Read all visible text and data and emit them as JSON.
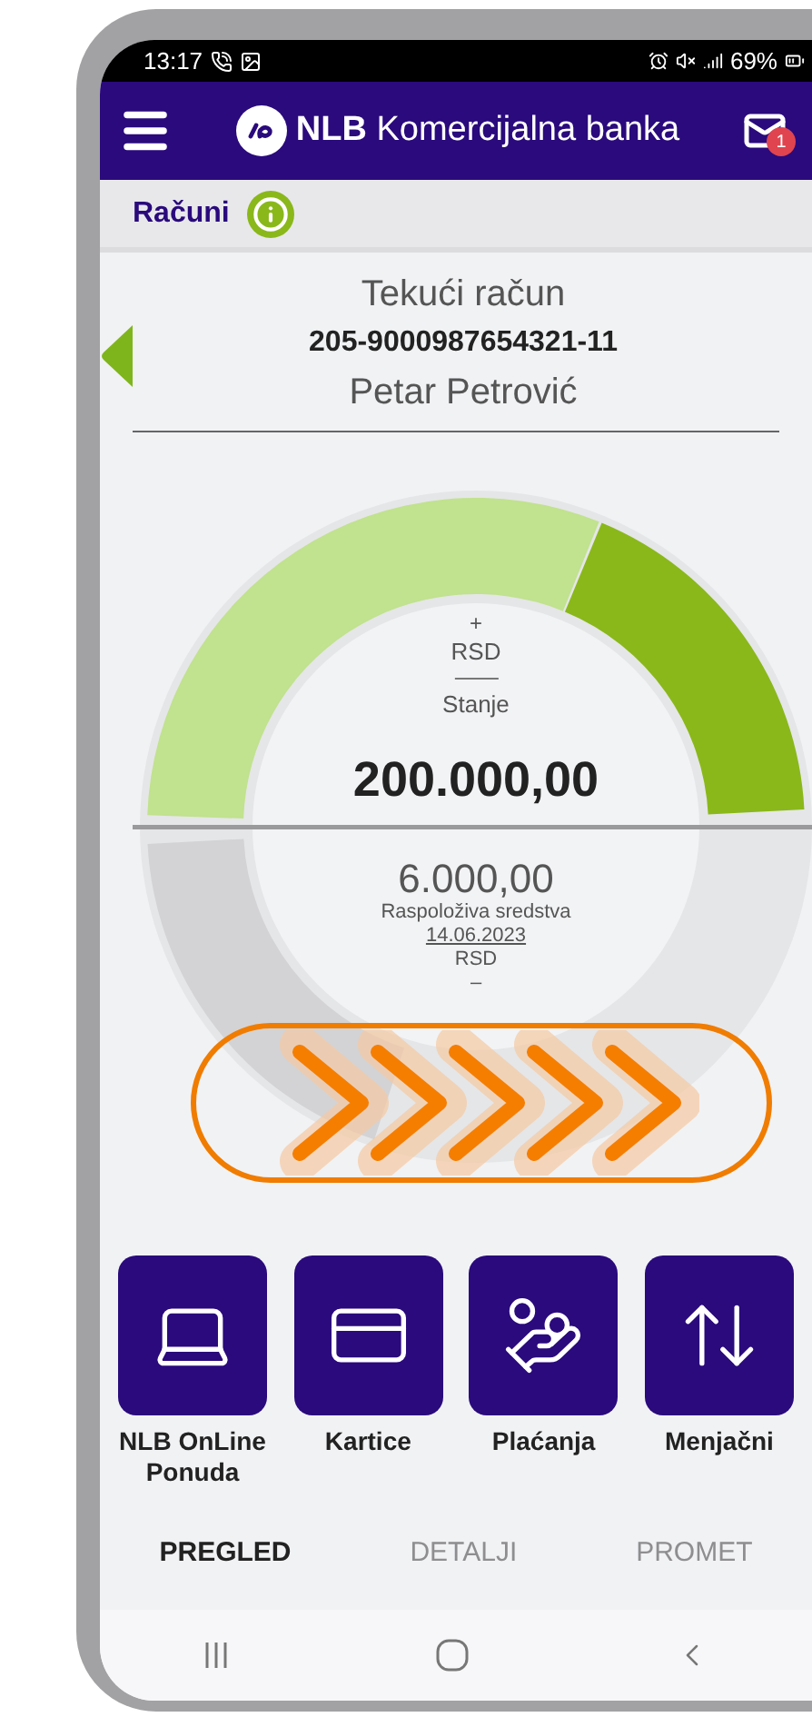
{
  "status_bar": {
    "time": "13:17",
    "battery": "69%"
  },
  "header": {
    "title": "**NLB** Komercijalna banka",
    "unread_count": "1"
  },
  "section": {
    "title": "Računi"
  },
  "account": {
    "type": "Tekući račun",
    "number": "205-9000987654321-11",
    "owner": "Petar Petrović"
  },
  "gauge": {
    "plus_sign": "+",
    "currency": "RSD",
    "balance_label": "Stanje",
    "balance": "200.000,00",
    "available": "6.000,00",
    "available_label": "Raspoloživa sredstva",
    "date": "14.06.2023",
    "available_currency": "RSD",
    "minus_sign": "–"
  },
  "shortcuts": [
    {
      "label": "NLB OnLine Ponuda",
      "kind": "offer"
    },
    {
      "label": "Kartice",
      "kind": "cards"
    },
    {
      "label": "Plaćanja",
      "kind": "payments"
    },
    {
      "label": "Menjačni",
      "kind": "exchange"
    }
  ],
  "tabs": [
    {
      "label": "PREGLED",
      "selected": true
    },
    {
      "label": "DETALJI",
      "selected": false
    },
    {
      "label": "PROMET",
      "selected": false
    }
  ]
}
